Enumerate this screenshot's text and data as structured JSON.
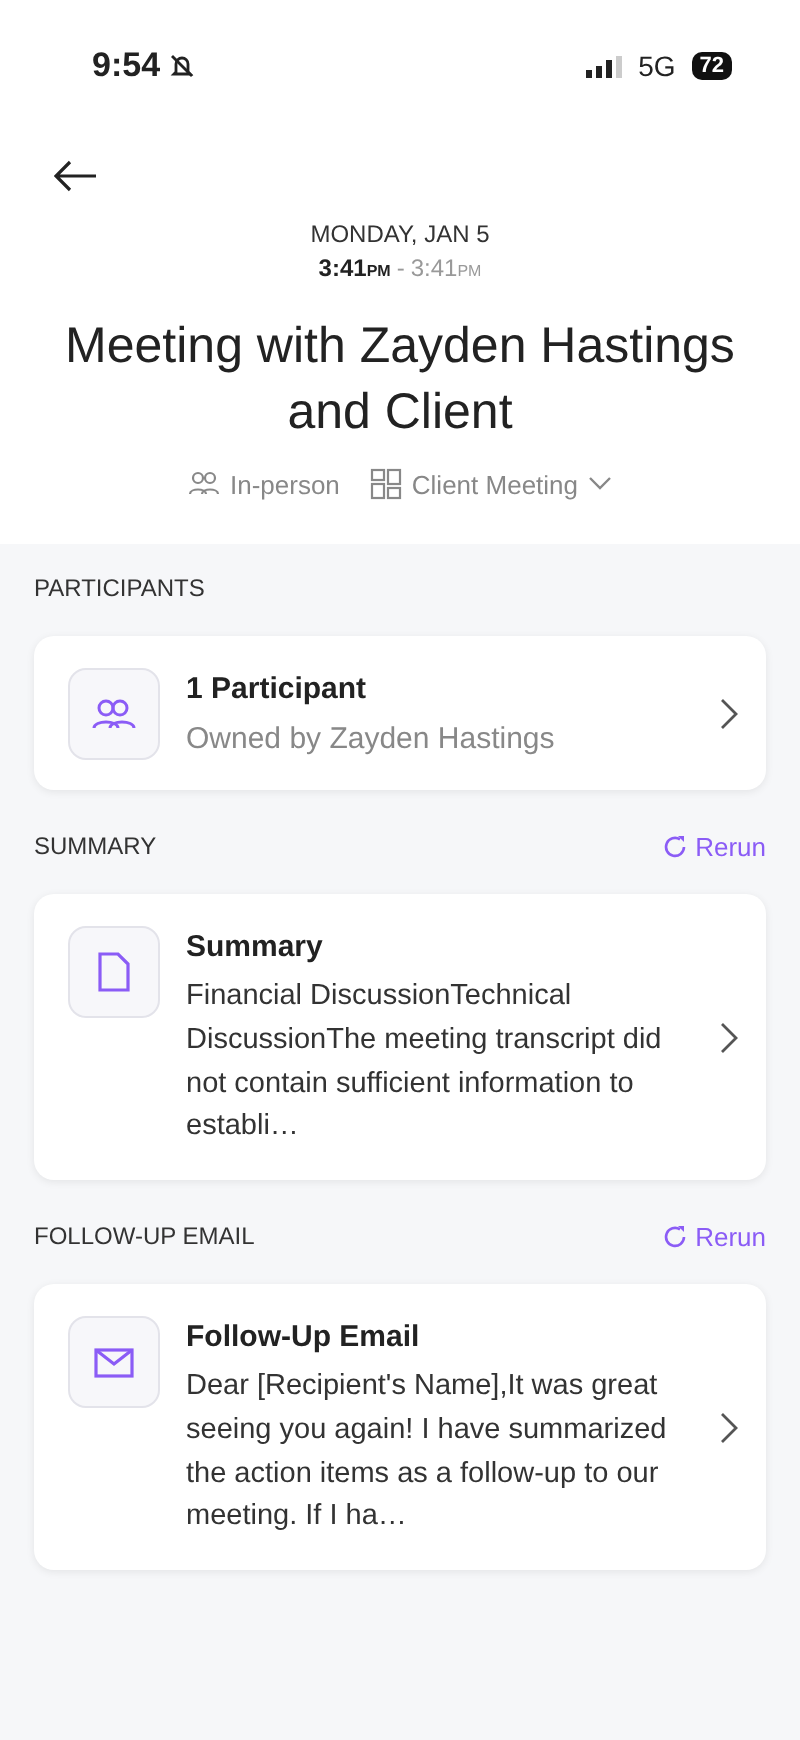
{
  "status_bar": {
    "time": "9:54",
    "network": "5G",
    "battery": "72"
  },
  "header": {
    "date_day": "MONDAY,",
    "date_rest": "JAN 5",
    "start": "3:41",
    "start_suffix": "PM",
    "separator": "-",
    "end": "3:41",
    "end_suffix": "PM",
    "title": "Meeting with Zayden Hastings and Client",
    "location": "In-person",
    "meeting_type": "Client Meeting"
  },
  "sections": [
    {
      "kind": "participants",
      "heading": "PARTICIPANTS",
      "card": {
        "title": "1 Participant",
        "subtitle": "Owned by Zayden Hastings"
      }
    },
    {
      "kind": "summary",
      "heading": "SUMMARY",
      "action": "Rerun",
      "card": {
        "title": "Summary",
        "body": "Financial DiscussionTechnical DiscussionThe meeting transcript did not contain sufficient information to establi…"
      }
    },
    {
      "kind": "email",
      "heading": "FOLLOW-UP EMAIL",
      "action": "Rerun",
      "card": {
        "title": "Follow-Up Email",
        "body": "Dear [Recipient's Name],It was great seeing you again! I have summarized the action items as a follow-up to our meeting. If I ha…"
      }
    }
  ]
}
